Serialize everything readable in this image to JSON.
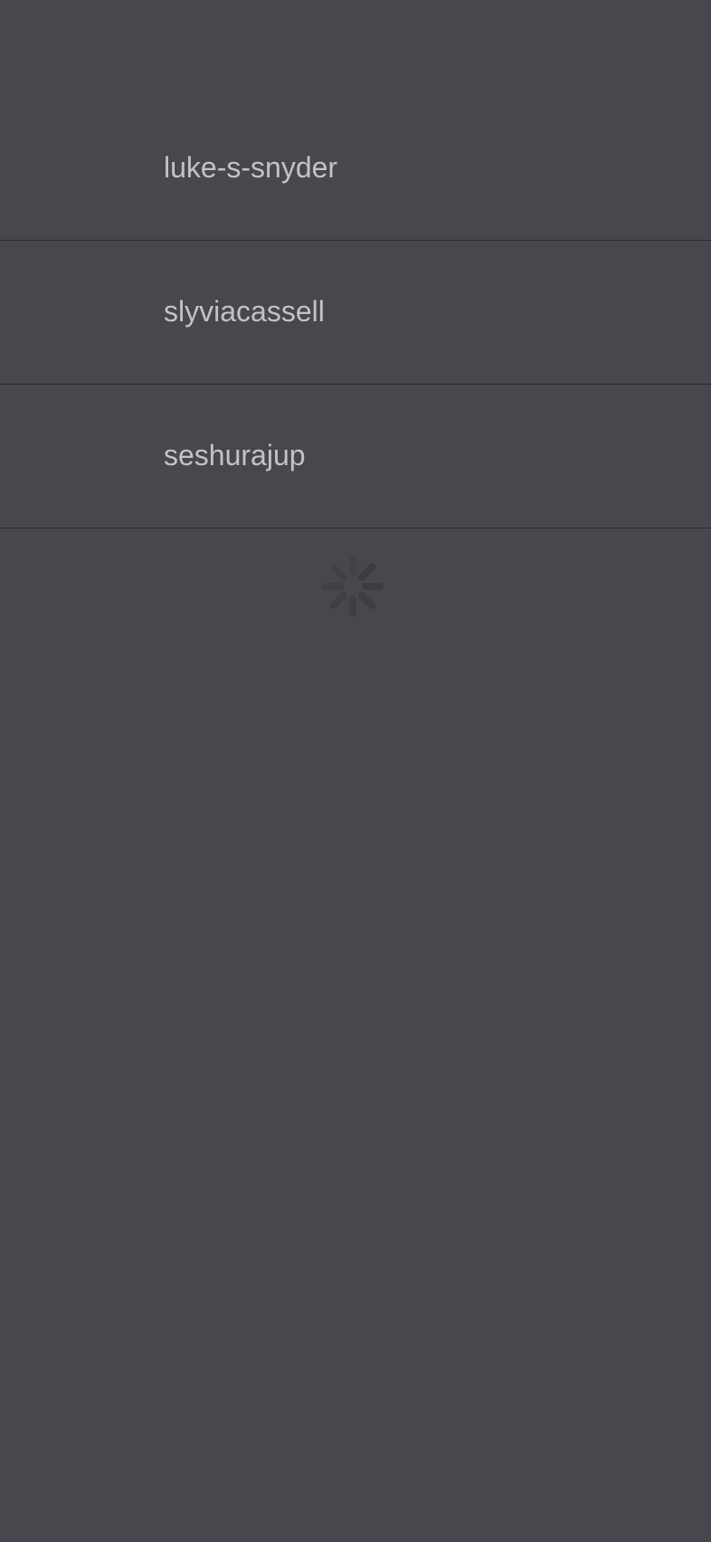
{
  "user_list": {
    "items": [
      {
        "label": "luke-s-snyder"
      },
      {
        "label": "slyviacassell"
      },
      {
        "label": "seshurajup"
      }
    ]
  },
  "loading_indicator": {
    "icon": "activity-spinner-icon",
    "color": "#3b3b40"
  },
  "colors": {
    "background": "#48474d",
    "separator": "#27282c",
    "text": "#c3c2c6"
  }
}
